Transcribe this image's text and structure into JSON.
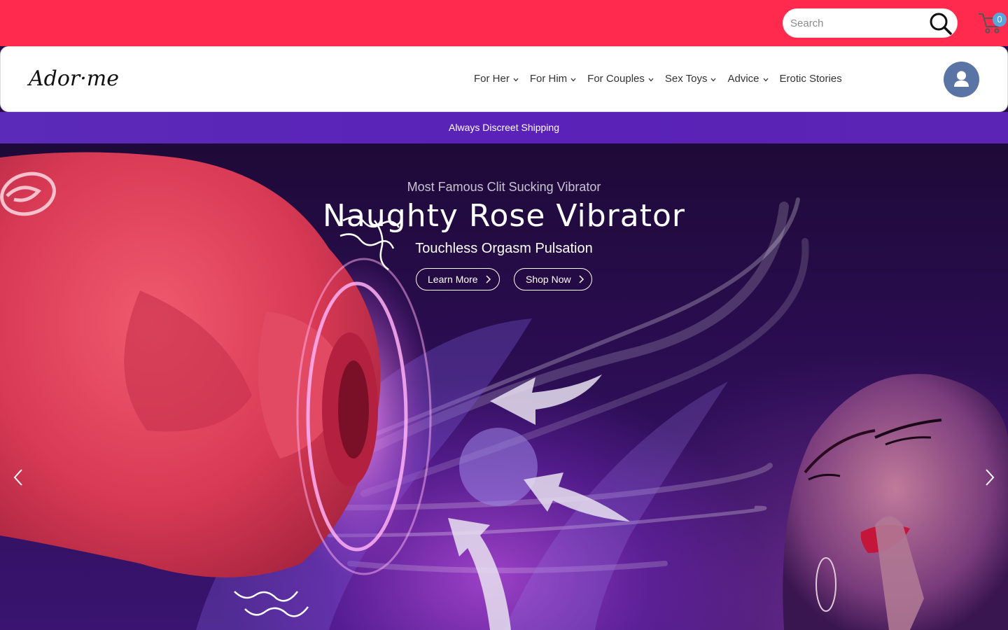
{
  "header": {
    "search_placeholder": "Search",
    "cart_count": "0",
    "brand_color": "#ff2a4d"
  },
  "logo": {
    "text": "Ador·me"
  },
  "nav": {
    "items": [
      {
        "label": "For Her"
      },
      {
        "label": "For Him"
      },
      {
        "label": "For Couples"
      },
      {
        "label": "Sex Toys"
      },
      {
        "label": "Advice"
      },
      {
        "label": "Erotic Stories"
      }
    ]
  },
  "banner": {
    "text": "Always Discreet Shipping",
    "color": "#5a22b8"
  },
  "hero": {
    "subtitle": "Most Famous Clit Sucking Vibrator",
    "title": "Naughty Rose Vibrator",
    "tagline": "Touchless Orgasm Pulsation",
    "learn_more": "Learn More",
    "shop_now": "Shop Now"
  },
  "icons": {
    "search": "search-icon",
    "cart": "cart-icon",
    "account": "user-icon",
    "prev": "chevron-left-icon",
    "next": "chevron-right-icon"
  }
}
